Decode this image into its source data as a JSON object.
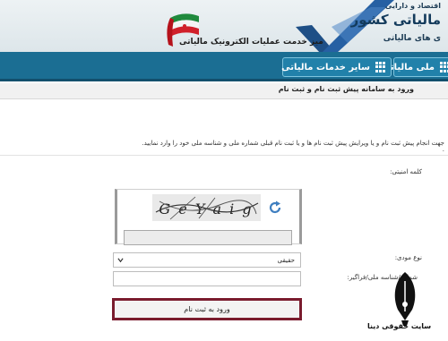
{
  "header": {
    "brand_top": "اقتصاد و دارایی",
    "brand_main": "مالیاتی کشور",
    "brand_sub": "ی های مالیاتی",
    "tagline": "میز خدمت عملیات الکترونیک مالیاتی"
  },
  "nav": {
    "items": [
      {
        "label": "ملی مالیاتی",
        "icon": "grid-icon"
      },
      {
        "label": "سایر خدمات مالیاتی",
        "icon": "grid-icon"
      }
    ]
  },
  "panel": {
    "title": "ورود به سامانه پیش ثبت نام و ثبت نام",
    "instructions_1": "جهت انجام پیش ثبت نام و یا ویرایش پیش ثبت نام ها و یا ثبت نام قبلی شماره ملی و شناسه ملی خود را وارد نمایید.",
    "instructions_2": "."
  },
  "form": {
    "captcha_label": "کلمه امنیتی:",
    "captcha_text": "G e Y a i g",
    "type_label": "نوع مودی:",
    "type_selected": "حقیقی",
    "id_label": "شماره/شناسه ملی/فراگیر:",
    "submit_label": "ورود به ثبت نام"
  },
  "watermark": {
    "text": "سایت حقوقی دینا"
  },
  "colors": {
    "navbar": "#1b6e93",
    "submit_border": "#7a1c2e",
    "brand_blue": "#133b5c"
  }
}
